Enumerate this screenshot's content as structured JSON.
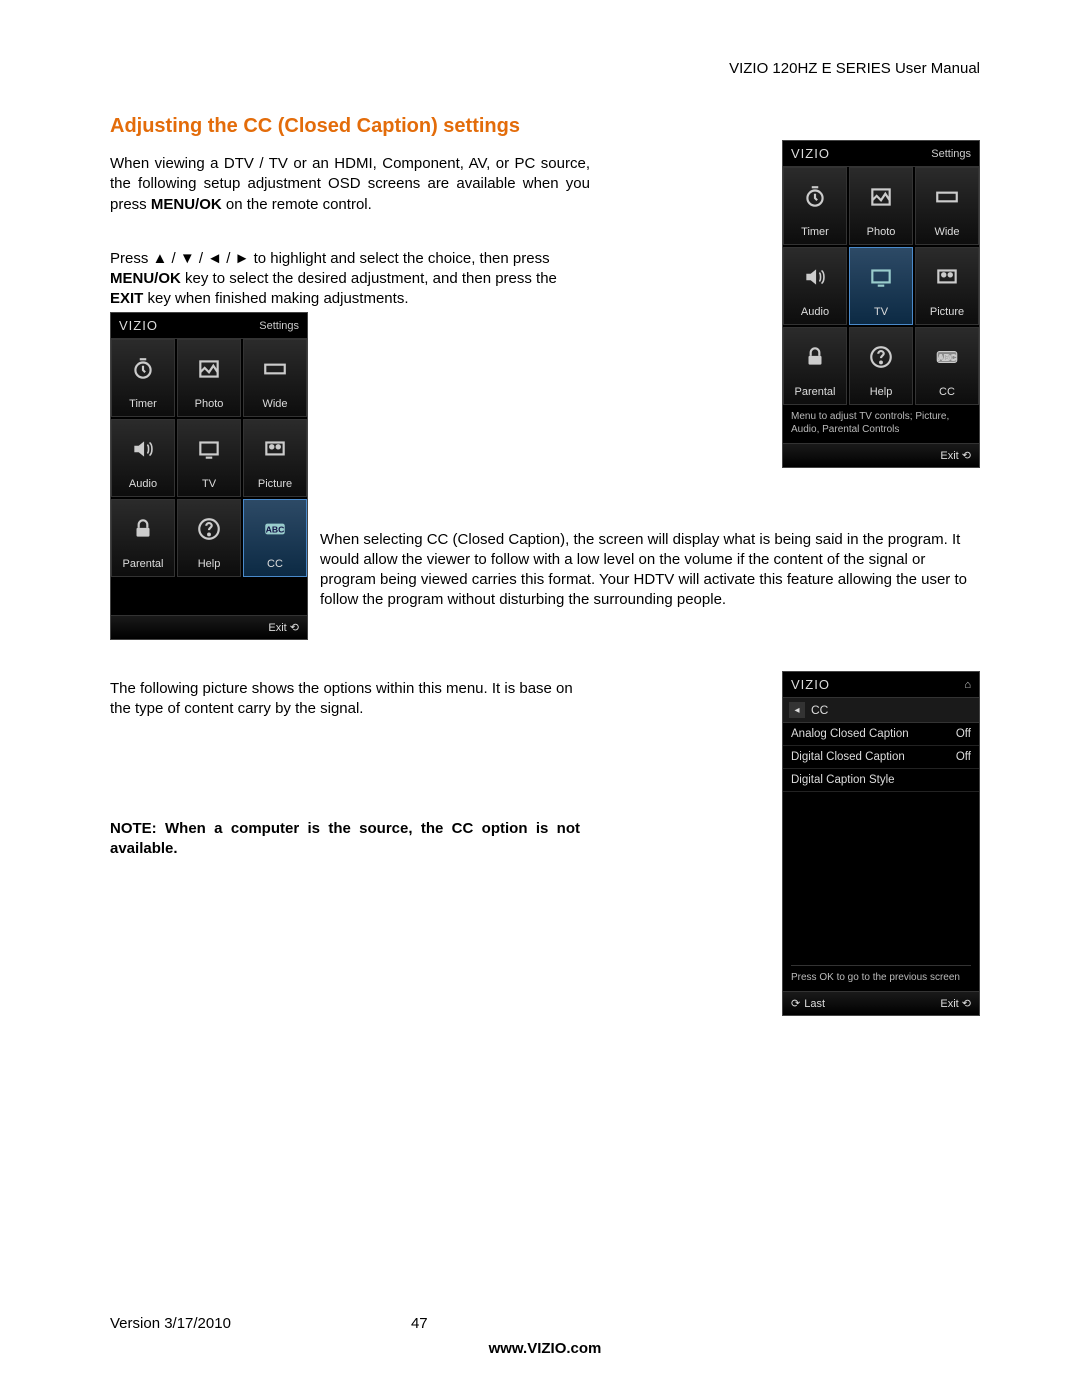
{
  "header": {
    "doc_title": "VIZIO 120HZ E SERIES User Manual"
  },
  "section": {
    "title": "Adjusting the CC (Closed Caption) settings"
  },
  "paragraphs": {
    "intro_a": "When viewing a DTV / TV or an HDMI, Component, AV, or PC source, the following setup adjustment OSD screens are available when you press ",
    "intro_b_bold": "MENU/OK",
    "intro_c": " on the remote control.",
    "nav_a": "Press ▲ / ▼ / ◄ / ► to highlight and select the choice, then press ",
    "nav_b_bold": "MENU/OK",
    "nav_c": " key to select the desired adjustment, and then press the ",
    "nav_d_bold": "EXIT",
    "nav_e": " key when finished making adjustments.",
    "cc_desc": "When selecting CC (Closed Caption), the screen will display what is being said in the program. It would allow the viewer to follow with a low level on the volume if the content of the signal or program being viewed carries this format. Your HDTV will activate this feature allowing the user to follow the program without disturbing the surrounding people.",
    "options_desc": "The following picture shows the options within this menu. It is base on the type of content carry by the signal.",
    "note_bold": "NOTE: When a computer is the source, the CC option is not available."
  },
  "osd_main": {
    "brand": "VIZIO",
    "right_label": "Settings",
    "cells": [
      {
        "label": "Timer",
        "icon": "clock"
      },
      {
        "label": "Photo",
        "icon": "photo"
      },
      {
        "label": "Wide",
        "icon": "wide"
      },
      {
        "label": "Audio",
        "icon": "audio"
      },
      {
        "label": "TV",
        "icon": "tv"
      },
      {
        "label": "Picture",
        "icon": "picture"
      },
      {
        "label": "Parental",
        "icon": "lock"
      },
      {
        "label": "Help",
        "icon": "help"
      },
      {
        "label": "CC",
        "icon": "cc"
      }
    ],
    "status_tv": "Menu to adjust TV controls; Picture, Audio, Parental Controls",
    "status_empty": "",
    "exit": "Exit"
  },
  "osd_cc": {
    "brand": "VIZIO",
    "title": "CC",
    "rows": [
      {
        "label": "Analog Closed Caption",
        "value": "Off"
      },
      {
        "label": "Digital Closed Caption",
        "value": "Off"
      },
      {
        "label": "Digital Caption Style",
        "value": ""
      }
    ],
    "hint": "Press OK to go to the previous screen",
    "last": "Last",
    "exit": "Exit"
  },
  "footer": {
    "version": "Version 3/17/2010",
    "page": "47",
    "url": "www.VIZIO.com"
  }
}
